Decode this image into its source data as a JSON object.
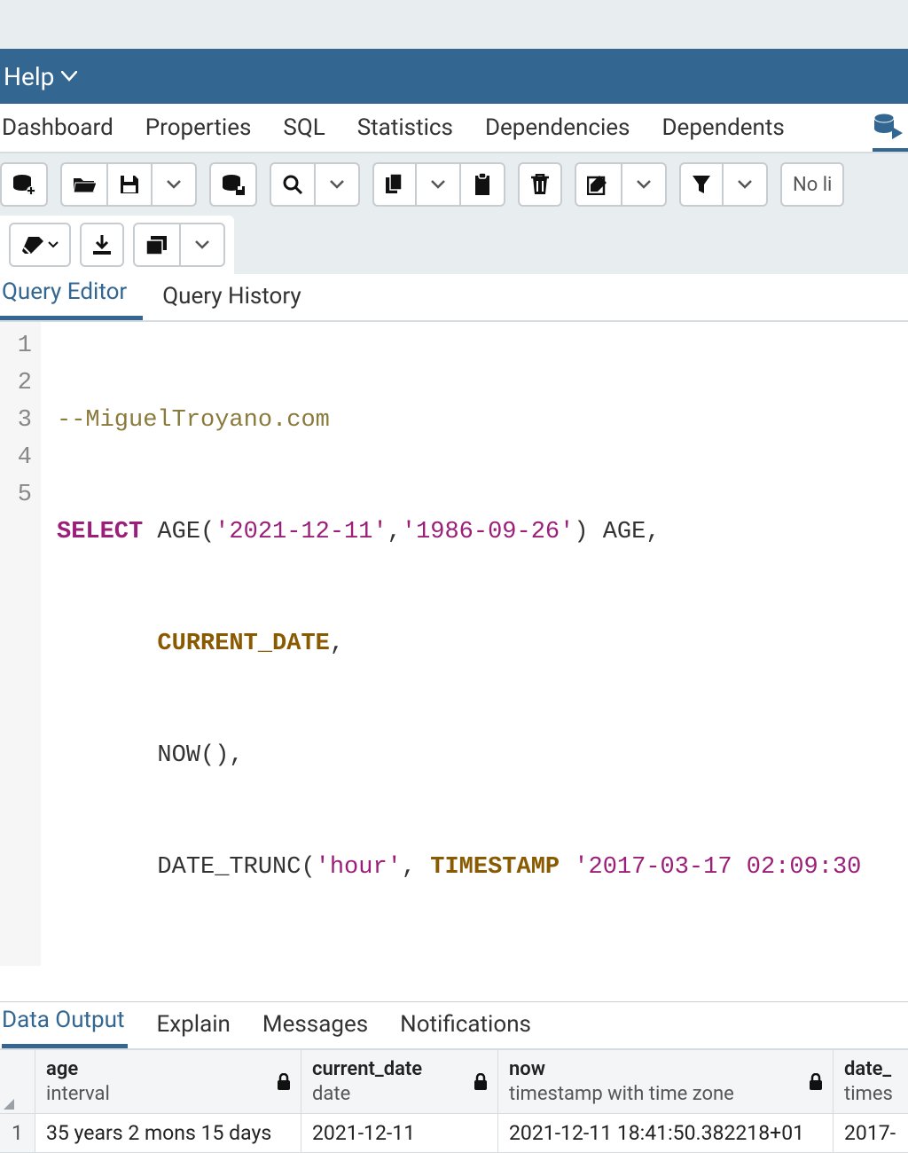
{
  "menubar": {
    "help": "Help"
  },
  "nav_tabs": {
    "dashboard": "Dashboard",
    "properties": "Properties",
    "sql": "SQL",
    "statistics": "Statistics",
    "dependencies": "Dependencies",
    "dependents": "Dependents"
  },
  "toolbar": {
    "nolimit": "No li"
  },
  "editor_tabs": {
    "query_editor": "Query Editor",
    "query_history": "Query History"
  },
  "code": {
    "lines": [
      "1",
      "2",
      "3",
      "4",
      "5"
    ],
    "l1_comment": "--MiguelTroyano.com",
    "l2_select": "SELECT",
    "l2_rest_a": " AGE(",
    "l2_str1": "'2021-12-11'",
    "l2_comma": ",",
    "l2_str2": "'1986-09-26'",
    "l2_rest_b": ") AGE,",
    "l3_kw": "CURRENT_DATE",
    "l3_tail": ",",
    "l4": "NOW(),",
    "l5_a": "DATE_TRUNC(",
    "l5_str": "'hour'",
    "l5_b": ", ",
    "l5_kw": "TIMESTAMP",
    "l5_c": " ",
    "l5_str2": "'2017-03-17 02:09:30"
  },
  "result_tabs": {
    "data_output": "Data Output",
    "explain": "Explain",
    "messages": "Messages",
    "notifications": "Notifications"
  },
  "grid": {
    "columns": [
      {
        "name": "age",
        "type": "interval"
      },
      {
        "name": "current_date",
        "type": "date"
      },
      {
        "name": "now",
        "type": "timestamp with time zone"
      },
      {
        "name": "date_",
        "type": "times"
      }
    ],
    "row1": {
      "num": "1",
      "age": "35 years 2 mons 15 days",
      "current_date": "2021-12-11",
      "now": "2021-12-11 18:41:50.382218+01",
      "date_trunc": "2017-"
    }
  }
}
